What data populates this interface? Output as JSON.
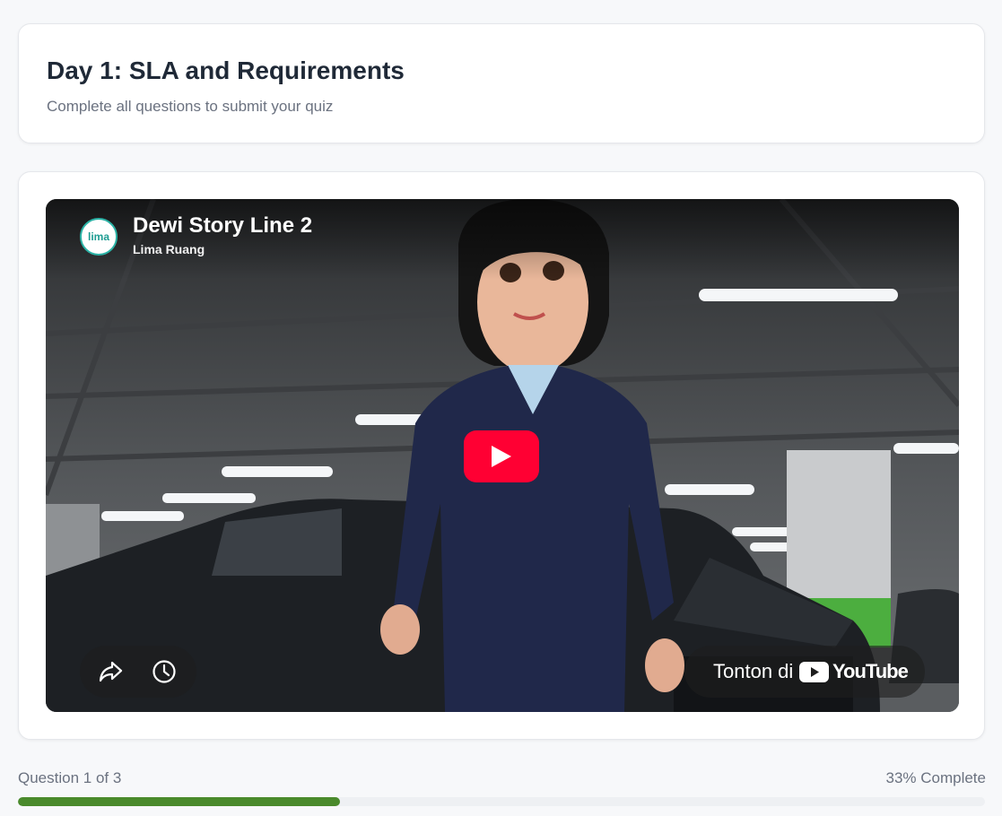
{
  "quiz": {
    "title": "Day 1: SLA and Requirements",
    "subtitle": "Complete all questions to submit your quiz"
  },
  "video": {
    "title": "Dewi Story Line 2",
    "channel": "Lima Ruang",
    "channel_logo_text": "lima",
    "watch_on": "Tonton di",
    "platform": "YouTube",
    "icons": [
      "play-icon",
      "share-icon",
      "watch-later-icon",
      "youtube-logo-icon"
    ]
  },
  "progress": {
    "question_text": "Question 1 of 3",
    "percent_text": "33% Complete",
    "fraction": 0.333,
    "fill_color": "#4a8a2c"
  },
  "colors": {
    "youtube_red": "#ff0033",
    "channel_accent": "#2bb3a6"
  }
}
